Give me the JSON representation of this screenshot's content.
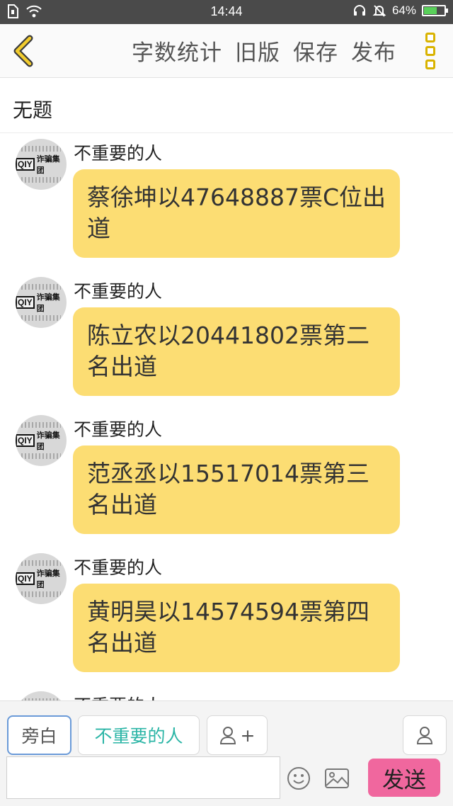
{
  "status_bar": {
    "time": "14:44",
    "battery_percent": "64%",
    "battery_level": 0.64,
    "left_icons": [
      "sim-card-icon",
      "wifi-icon"
    ],
    "right_icons": [
      "headset-icon",
      "mute-bell-icon",
      "battery-icon"
    ]
  },
  "nav": {
    "back_icon": "chevron-left-icon",
    "actions": [
      "字数统计",
      "旧版",
      "保存",
      "发布"
    ],
    "more_icon": "more-vertical-icon"
  },
  "title": "无题",
  "messages": [
    {
      "sender": "不重要的人",
      "text": "蔡徐坤以47648887票C位出道"
    },
    {
      "sender": "不重要的人",
      "text": "陈立农以20441802票第二名出道"
    },
    {
      "sender": "不重要的人",
      "text": "范丞丞以15517014票第三名出道"
    },
    {
      "sender": "不重要的人",
      "text": "黄明昊以14574594票第四名出道"
    },
    {
      "sender": "不重要的人",
      "text": ""
    }
  ],
  "avatar": {
    "logo": "QIY",
    "caption": "诈骗集团"
  },
  "bottom": {
    "narration": "旁白",
    "role": "不重要的人",
    "add_role_symbol": "+",
    "input_value": "",
    "send": "发送"
  },
  "colors": {
    "bubble": "#fcdd73",
    "accent": "#d9b300",
    "role_text": "#2bb5a6",
    "send_button": "#f0679e",
    "status_bar": "#4a4a4a"
  }
}
